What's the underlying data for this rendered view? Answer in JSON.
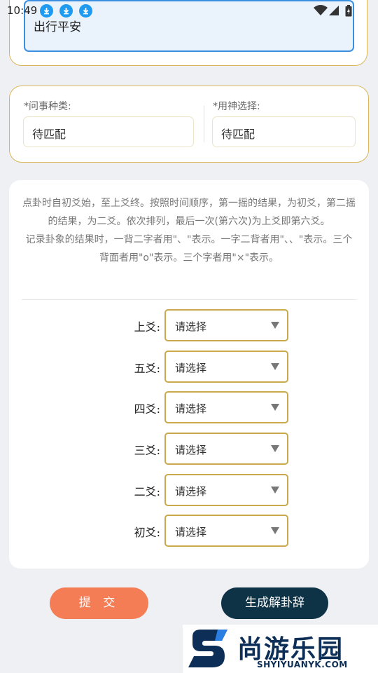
{
  "status_bar": {
    "time": "10:49"
  },
  "question": {
    "value": "出行平安"
  },
  "selectors": {
    "category": {
      "label": "*问事种类:",
      "value": "待匹配"
    },
    "yongshen": {
      "label": "*用神选择:",
      "value": "待匹配"
    }
  },
  "instructions": {
    "para1": "点卦时自初爻始，至上爻终。按照时间顺序，第一摇的结果，为初爻，第二摇的结果，为二爻。依次排列，最后一次(第六次)为上爻即第六爻。",
    "para2": "记录卦象的结果时，一背二字者用\"、\"表示。一字二背者用\"、、\"表示。三个背面者用\"o\"表示。三个字者用\"×\"表示。"
  },
  "yao_rows": [
    {
      "label": "上爻:",
      "placeholder": "请选择"
    },
    {
      "label": "五爻:",
      "placeholder": "请选择"
    },
    {
      "label": "四爻:",
      "placeholder": "请选择"
    },
    {
      "label": "三爻:",
      "placeholder": "请选择"
    },
    {
      "label": "二爻:",
      "placeholder": "请选择"
    },
    {
      "label": "初爻:",
      "placeholder": "请选择"
    }
  ],
  "buttons": {
    "submit": "提 交",
    "generate": "生成解卦辞"
  },
  "watermark": {
    "name": "尚游乐园",
    "url": "SHYIYUANYK.COM"
  },
  "colors": {
    "accent_gold": "#d9b75a",
    "submit": "#f47d56",
    "generate": "#0f3346",
    "input_blue": "#3b8fe0"
  }
}
